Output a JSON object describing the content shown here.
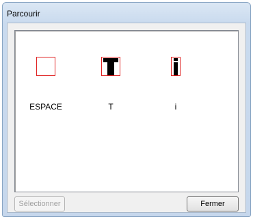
{
  "window": {
    "title": "Parcourir"
  },
  "glyphs": [
    {
      "label": "ESPACE",
      "icon": "empty-glyph-box"
    },
    {
      "label": "T",
      "icon": "t-glyph"
    },
    {
      "label": "i",
      "icon": "i-glyph"
    }
  ],
  "buttons": {
    "select": "Sélectionner",
    "close": "Fermer"
  },
  "colors": {
    "glyph_border": "#e02424",
    "glyph_fill": "#000000"
  }
}
